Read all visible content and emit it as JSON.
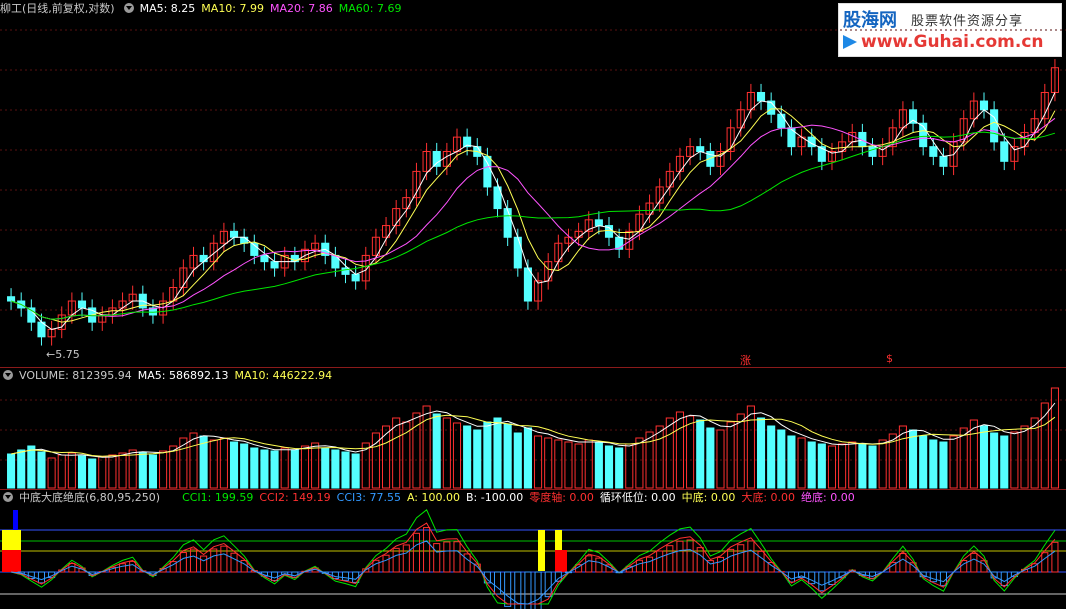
{
  "main": {
    "stock_title": "柳工(日线,前复权,对数)",
    "ma5": "MA5: 8.25",
    "ma10": "MA10: 7.99",
    "ma20": "MA20: 7.86",
    "ma60": "MA60: 7.69",
    "low_label": "5.75",
    "marker_zhang": "涨",
    "marker_s": "$"
  },
  "logo": {
    "brand": "股海网",
    "tagline": "股票软件资源分享",
    "url": "www.Guhai.com.cn"
  },
  "volume": {
    "title": "VOLUME: 812395.94",
    "ma5": "MA5: 586892.13",
    "ma10": "MA10: 446222.94"
  },
  "indicator": {
    "title": "中底大底绝底(6,80,95,250)",
    "cci1": "CCI1: 199.59",
    "cci2": "CCI2: 149.19",
    "cci3": "CCI3: 77.55",
    "a": "A: 100.00",
    "b": "B: -100.00",
    "zero_axis": "零度轴: 0.00",
    "cycle_low": "循环低位: 0.00",
    "mid_bottom": "中底: 0.00",
    "big_bottom": "大底: 0.00",
    "abs_bottom": "绝底: 0.00"
  },
  "colors": {
    "up": "#ff3030",
    "down": "#54ffff",
    "ma5": "#ffffff",
    "ma10": "#ffff54",
    "ma20": "#ff54ff",
    "ma60": "#00e600"
  },
  "chart_data": {
    "type": "candlestick",
    "y_scale": "log",
    "close": [
      6.3,
      6.2,
      6.0,
      5.8,
      5.9,
      6.1,
      6.3,
      6.2,
      6.0,
      6.1,
      6.2,
      6.3,
      6.4,
      6.2,
      6.1,
      6.3,
      6.5,
      6.8,
      7.0,
      6.9,
      7.2,
      7.4,
      7.3,
      7.2,
      7.0,
      6.9,
      6.8,
      7.0,
      6.9,
      7.1,
      7.2,
      7.0,
      6.8,
      6.7,
      6.6,
      7.0,
      7.3,
      7.5,
      7.8,
      8.0,
      8.5,
      8.9,
      8.6,
      8.9,
      9.2,
      9.0,
      8.8,
      8.2,
      7.8,
      7.3,
      6.8,
      6.3,
      6.6,
      6.9,
      7.2,
      7.3,
      7.4,
      7.6,
      7.5,
      7.3,
      7.1,
      7.4,
      7.7,
      7.9,
      8.2,
      8.5,
      8.8,
      9.0,
      8.9,
      8.6,
      8.9,
      9.4,
      9.8,
      10.2,
      10.0,
      9.7,
      9.4,
      9.0,
      9.2,
      9.0,
      8.7,
      8.9,
      9.1,
      9.3,
      9.0,
      8.8,
      9.0,
      9.4,
      9.8,
      9.5,
      9.0,
      8.8,
      8.6,
      9.1,
      9.6,
      10.0,
      9.8,
      9.1,
      8.7,
      9.0,
      9.3,
      9.6,
      10.2,
      10.8
    ],
    "volume": [
      0.34,
      0.38,
      0.42,
      0.36,
      0.3,
      0.33,
      0.35,
      0.32,
      0.29,
      0.31,
      0.33,
      0.35,
      0.38,
      0.36,
      0.33,
      0.37,
      0.42,
      0.5,
      0.55,
      0.52,
      0.48,
      0.5,
      0.46,
      0.44,
      0.4,
      0.38,
      0.37,
      0.4,
      0.38,
      0.42,
      0.45,
      0.4,
      0.38,
      0.36,
      0.34,
      0.45,
      0.55,
      0.62,
      0.7,
      0.66,
      0.75,
      0.82,
      0.74,
      0.7,
      0.65,
      0.62,
      0.58,
      0.66,
      0.7,
      0.64,
      0.55,
      0.6,
      0.52,
      0.5,
      0.48,
      0.46,
      0.44,
      0.48,
      0.46,
      0.42,
      0.4,
      0.44,
      0.5,
      0.56,
      0.62,
      0.7,
      0.76,
      0.72,
      0.68,
      0.6,
      0.58,
      0.66,
      0.74,
      0.82,
      0.7,
      0.62,
      0.58,
      0.52,
      0.5,
      0.46,
      0.44,
      0.42,
      0.44,
      0.46,
      0.44,
      0.42,
      0.48,
      0.54,
      0.62,
      0.58,
      0.52,
      0.48,
      0.46,
      0.52,
      0.6,
      0.68,
      0.62,
      0.55,
      0.52,
      0.56,
      0.62,
      0.7,
      0.85,
      1.0
    ]
  }
}
